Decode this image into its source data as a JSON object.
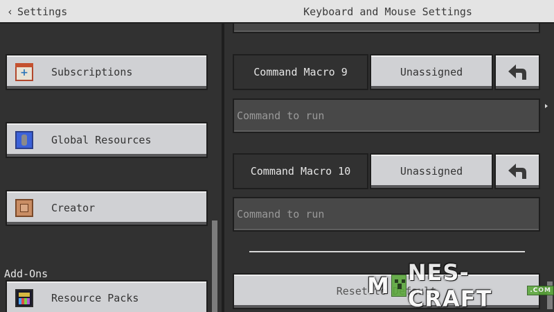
{
  "header": {
    "back_label": "Settings",
    "title": "Keyboard and Mouse Settings"
  },
  "sidebar": {
    "items": [
      {
        "label": "Subscriptions",
        "icon": "subscriptions-icon"
      },
      {
        "label": "Global Resources",
        "icon": "global-resources-icon"
      },
      {
        "label": "Creator",
        "icon": "creator-icon"
      }
    ],
    "section_label": "Add-Ons",
    "addons": [
      {
        "label": "Resource Packs",
        "icon": "resource-packs-icon"
      }
    ]
  },
  "macros": [
    {
      "label": "Command Macro 9",
      "binding": "Unassigned",
      "command_placeholder": "Command to run"
    },
    {
      "label": "Command Macro 10",
      "binding": "Unassigned",
      "command_placeholder": "Command to run"
    }
  ],
  "reset_label": "Reset to Default",
  "watermark": {
    "text_left": "M",
    "text_right": "NES-CRAFT",
    "suffix": ".COM"
  },
  "colors": {
    "background": "#313131",
    "button": "#d0d1d4",
    "header": "#e4e4e4",
    "field": "#484848"
  }
}
